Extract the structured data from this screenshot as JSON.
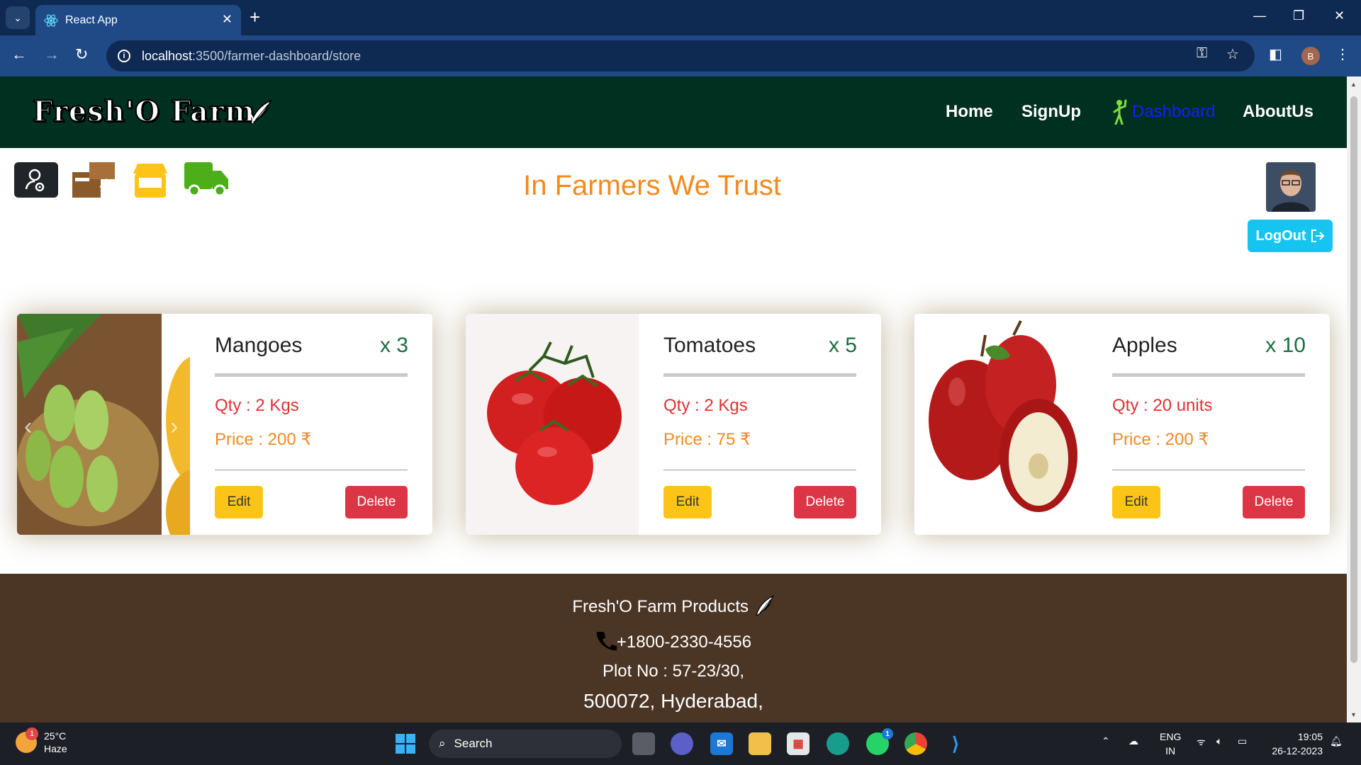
{
  "browser": {
    "tab_title": "React App",
    "url_host": "localhost",
    "url_path": ":3500/farmer-dashboard/store",
    "profile_initial": "B"
  },
  "site": {
    "brand": "Fresh'O Farm",
    "nav": {
      "home": "Home",
      "signup": "SignUp",
      "dashboard": "Dashboard",
      "about": "AboutUs"
    },
    "slogan": "In Farmers We Trust",
    "logout_label": "LogOut",
    "colors": {
      "nav_bg": "#003020",
      "slogan": "#f28a1e",
      "footer_bg": "#4b3626",
      "logout": "#16c5ef"
    }
  },
  "products": [
    {
      "name": "Mangoes",
      "count": "x 3",
      "qty": "Qty : 2 Kgs",
      "price": "Price : 200 ₹",
      "edit": "Edit",
      "delete": "Delete"
    },
    {
      "name": "Tomatoes",
      "count": "x 5",
      "qty": "Qty : 2 Kgs",
      "price": "Price : 75 ₹",
      "edit": "Edit",
      "delete": "Delete"
    },
    {
      "name": "Apples",
      "count": "x 10",
      "qty": "Qty : 20 units",
      "price": "Price : 200 ₹",
      "edit": "Edit",
      "delete": "Delete"
    }
  ],
  "footer": {
    "title": "Fresh'O Farm Products",
    "phone": "+1800-2330-4556",
    "plot": "Plot No : 57-23/30,",
    "city": "500072, Hyderabad,"
  },
  "taskbar": {
    "weather_temp": "25°C",
    "weather_desc": "Haze",
    "weather_badge": "1",
    "search_label": "Search",
    "lang_1": "ENG",
    "lang_2": "IN",
    "time": "19:05",
    "date": "26-12-2023",
    "whatsapp_badge": "1"
  }
}
